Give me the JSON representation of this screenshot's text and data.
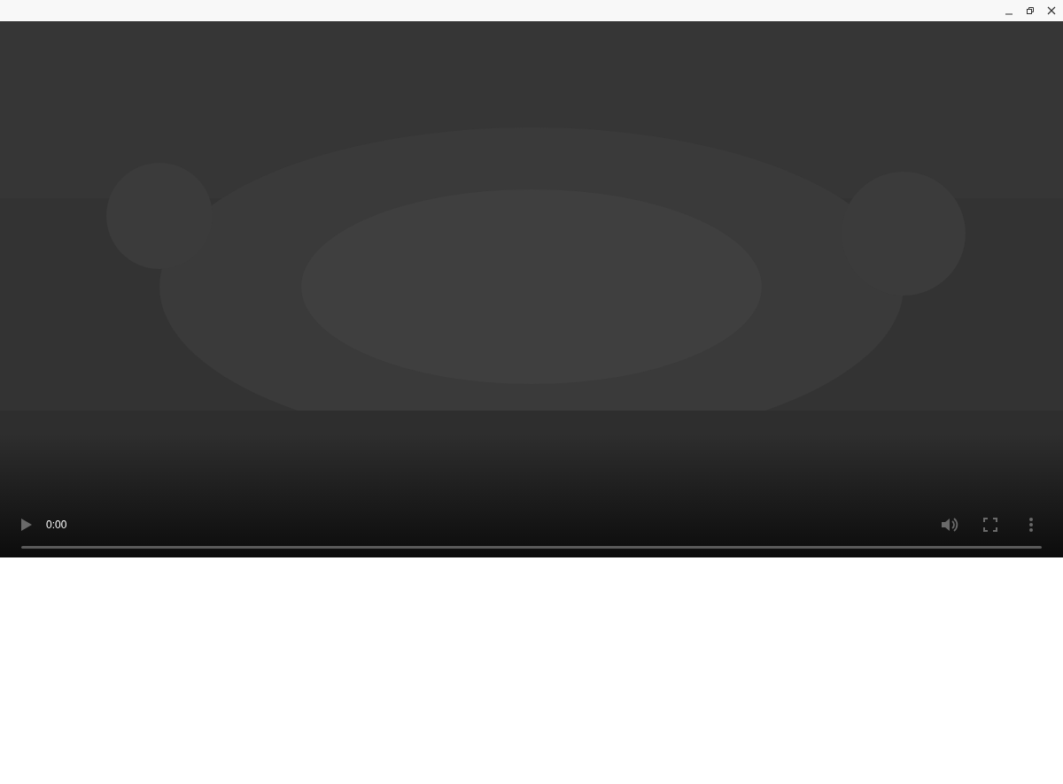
{
  "video": {
    "kind": "picture",
    "time": "0:00",
    "progress": {
      "level": 0
    }
  }
}
